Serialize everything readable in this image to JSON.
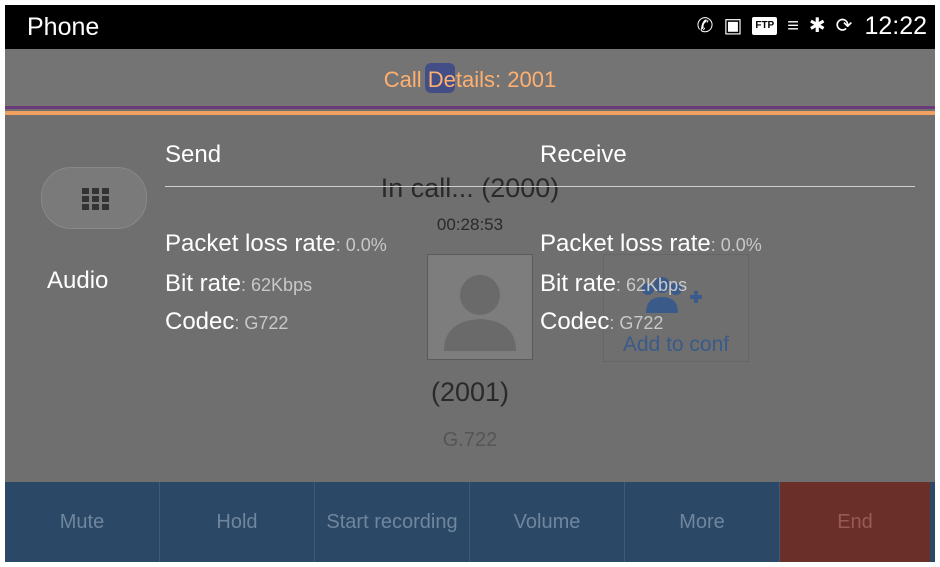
{
  "statusbar": {
    "app_name": "Phone",
    "time": "12:22",
    "icons": [
      "call-active-icon",
      "image-icon",
      "ftp-icon",
      "usb-icon",
      "bluetooth-icon",
      "sync-icon"
    ],
    "ftp_text": "FTP"
  },
  "dialog": {
    "title": "Call Details: 2001",
    "title_color": "#ffb070",
    "send_header": "Send",
    "receive_header": "Receive",
    "row_label": "Audio",
    "send": {
      "loss_label": "Packet loss rate",
      "loss_value": ": 0.0%",
      "bitrate_label": "Bit rate",
      "bitrate_value": ": 62Kbps",
      "codec_label": "Codec",
      "codec_value": ": G722"
    },
    "receive": {
      "loss_label": "Packet loss rate",
      "loss_value": ": 0.0%",
      "bitrate_label": "Bit rate",
      "bitrate_value": ": 62Kbps",
      "codec_label": "Codec",
      "codec_value": ": G722"
    }
  },
  "call": {
    "status": "In call... (2000)",
    "timer": "00:28:53",
    "caller_number": "(2001)",
    "caller_codec": "G.722",
    "add_conf_label": "Add to conf"
  },
  "bottom_bar": {
    "buttons": [
      "Mute",
      "Hold",
      "Start recording",
      "Volume",
      "More",
      "End"
    ],
    "bar_color": "#2b4866",
    "end_color": "#6b2f2a"
  }
}
